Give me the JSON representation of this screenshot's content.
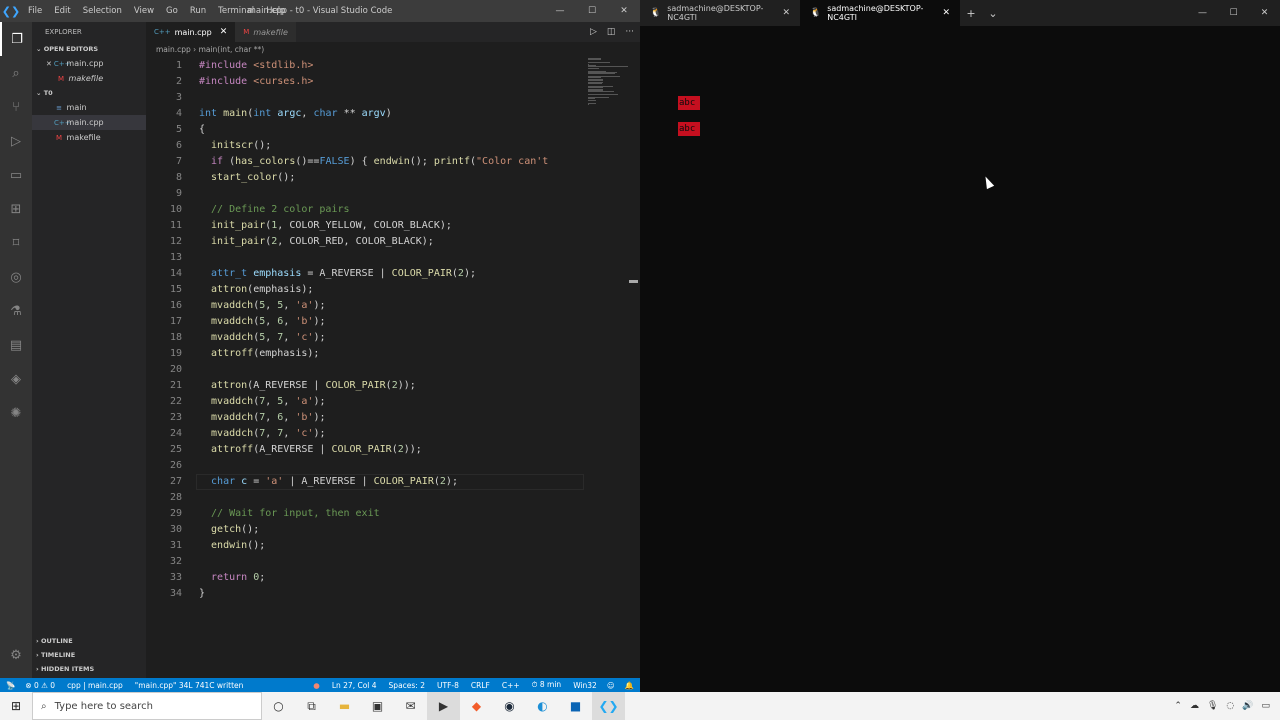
{
  "vscode": {
    "menu": [
      "File",
      "Edit",
      "Selection",
      "View",
      "Go",
      "Run",
      "Terminal",
      "Help"
    ],
    "window_title": "main.cpp - t0 - Visual Studio Code",
    "explorer_label": "EXPLORER",
    "open_editors_label": "OPEN EDITORS",
    "open_editors": [
      {
        "name": "main.cpp",
        "icon": "C++"
      },
      {
        "name": "makefile",
        "icon": "M"
      }
    ],
    "folder_name": "T0",
    "files": [
      {
        "name": "main",
        "icon": "≡"
      },
      {
        "name": "main.cpp",
        "icon": "C++"
      },
      {
        "name": "makefile",
        "icon": "M"
      }
    ],
    "outline_label": "OUTLINE",
    "timeline_label": "TIMELINE",
    "hidden_label": "HIDDEN ITEMS",
    "tabs": [
      {
        "name": "main.cpp",
        "icon": "C++"
      },
      {
        "name": "makefile",
        "icon": "M"
      }
    ],
    "breadcrumb": [
      "main.cpp",
      "main(int, char **)"
    ],
    "code": [
      [
        [
          "#include ",
          "#c586c0"
        ],
        [
          "<stdlib.h>",
          "#ce9178"
        ]
      ],
      [
        [
          "#include ",
          "#c586c0"
        ],
        [
          "<curses.h>",
          "#ce9178"
        ]
      ],
      [],
      [
        [
          "int ",
          "#569cd6"
        ],
        [
          "main",
          "#dcdcaa"
        ],
        [
          "(",
          "#d4d4d4"
        ],
        [
          "int ",
          "#569cd6"
        ],
        [
          "argc",
          "#9cdcfe"
        ],
        [
          ", ",
          "#d4d4d4"
        ],
        [
          "char ",
          "#569cd6"
        ],
        [
          "** ",
          "#d4d4d4"
        ],
        [
          "argv",
          "#9cdcfe"
        ],
        [
          ")",
          "#d4d4d4"
        ]
      ],
      [
        [
          "{",
          "#d4d4d4"
        ]
      ],
      [
        [
          "  initscr",
          "#dcdcaa"
        ],
        [
          "();",
          "#d4d4d4"
        ]
      ],
      [
        [
          "  if ",
          "#c586c0"
        ],
        [
          "(",
          "#d4d4d4"
        ],
        [
          "has_colors",
          "#dcdcaa"
        ],
        [
          "()==",
          "#d4d4d4"
        ],
        [
          "FALSE",
          "#569cd6"
        ],
        [
          ") { ",
          "#d4d4d4"
        ],
        [
          "endwin",
          "#dcdcaa"
        ],
        [
          "(); ",
          "#d4d4d4"
        ],
        [
          "printf",
          "#dcdcaa"
        ],
        [
          "(",
          "#d4d4d4"
        ],
        [
          "\"Color can't",
          "#ce9178"
        ]
      ],
      [
        [
          "  start_color",
          "#dcdcaa"
        ],
        [
          "();",
          "#d4d4d4"
        ]
      ],
      [],
      [
        [
          "  // Define 2 color pairs",
          "#6a9955"
        ]
      ],
      [
        [
          "  init_pair",
          "#dcdcaa"
        ],
        [
          "(",
          "#d4d4d4"
        ],
        [
          "1",
          "#b5cea8"
        ],
        [
          ", COLOR_YELLOW, COLOR_BLACK);",
          "#d4d4d4"
        ]
      ],
      [
        [
          "  init_pair",
          "#dcdcaa"
        ],
        [
          "(",
          "#d4d4d4"
        ],
        [
          "2",
          "#b5cea8"
        ],
        [
          ", COLOR_RED, COLOR_BLACK);",
          "#d4d4d4"
        ]
      ],
      [],
      [
        [
          "  attr_t ",
          "#569cd6"
        ],
        [
          "emphasis ",
          "#9cdcfe"
        ],
        [
          "= A_REVERSE ",
          "#d4d4d4"
        ],
        [
          "| ",
          "#d4d4d4"
        ],
        [
          "COLOR_PAIR",
          "#dcdcaa"
        ],
        [
          "(",
          "#d4d4d4"
        ],
        [
          "2",
          "#b5cea8"
        ],
        [
          ");",
          "#d4d4d4"
        ]
      ],
      [
        [
          "  attron",
          "#dcdcaa"
        ],
        [
          "(emphasis);",
          "#d4d4d4"
        ]
      ],
      [
        [
          "  mvaddch",
          "#dcdcaa"
        ],
        [
          "(",
          "#d4d4d4"
        ],
        [
          "5",
          "#b5cea8"
        ],
        [
          ", ",
          "#d4d4d4"
        ],
        [
          "5",
          "#b5cea8"
        ],
        [
          ", ",
          "#d4d4d4"
        ],
        [
          "'a'",
          "#ce9178"
        ],
        [
          ");",
          "#d4d4d4"
        ]
      ],
      [
        [
          "  mvaddch",
          "#dcdcaa"
        ],
        [
          "(",
          "#d4d4d4"
        ],
        [
          "5",
          "#b5cea8"
        ],
        [
          ", ",
          "#d4d4d4"
        ],
        [
          "6",
          "#b5cea8"
        ],
        [
          ", ",
          "#d4d4d4"
        ],
        [
          "'b'",
          "#ce9178"
        ],
        [
          ");",
          "#d4d4d4"
        ]
      ],
      [
        [
          "  mvaddch",
          "#dcdcaa"
        ],
        [
          "(",
          "#d4d4d4"
        ],
        [
          "5",
          "#b5cea8"
        ],
        [
          ", ",
          "#d4d4d4"
        ],
        [
          "7",
          "#b5cea8"
        ],
        [
          ", ",
          "#d4d4d4"
        ],
        [
          "'c'",
          "#ce9178"
        ],
        [
          ");",
          "#d4d4d4"
        ]
      ],
      [
        [
          "  attroff",
          "#dcdcaa"
        ],
        [
          "(emphasis);",
          "#d4d4d4"
        ]
      ],
      [],
      [
        [
          "  attron",
          "#dcdcaa"
        ],
        [
          "(A_REVERSE | ",
          "#d4d4d4"
        ],
        [
          "COLOR_PAIR",
          "#dcdcaa"
        ],
        [
          "(",
          "#d4d4d4"
        ],
        [
          "2",
          "#b5cea8"
        ],
        [
          "));",
          "#d4d4d4"
        ]
      ],
      [
        [
          "  mvaddch",
          "#dcdcaa"
        ],
        [
          "(",
          "#d4d4d4"
        ],
        [
          "7",
          "#b5cea8"
        ],
        [
          ", ",
          "#d4d4d4"
        ],
        [
          "5",
          "#b5cea8"
        ],
        [
          ", ",
          "#d4d4d4"
        ],
        [
          "'a'",
          "#ce9178"
        ],
        [
          ");",
          "#d4d4d4"
        ]
      ],
      [
        [
          "  mvaddch",
          "#dcdcaa"
        ],
        [
          "(",
          "#d4d4d4"
        ],
        [
          "7",
          "#b5cea8"
        ],
        [
          ", ",
          "#d4d4d4"
        ],
        [
          "6",
          "#b5cea8"
        ],
        [
          ", ",
          "#d4d4d4"
        ],
        [
          "'b'",
          "#ce9178"
        ],
        [
          ");",
          "#d4d4d4"
        ]
      ],
      [
        [
          "  mvaddch",
          "#dcdcaa"
        ],
        [
          "(",
          "#d4d4d4"
        ],
        [
          "7",
          "#b5cea8"
        ],
        [
          ", ",
          "#d4d4d4"
        ],
        [
          "7",
          "#b5cea8"
        ],
        [
          ", ",
          "#d4d4d4"
        ],
        [
          "'c'",
          "#ce9178"
        ],
        [
          ");",
          "#d4d4d4"
        ]
      ],
      [
        [
          "  attroff",
          "#dcdcaa"
        ],
        [
          "(A_REVERSE | ",
          "#d4d4d4"
        ],
        [
          "COLOR_PAIR",
          "#dcdcaa"
        ],
        [
          "(",
          "#d4d4d4"
        ],
        [
          "2",
          "#b5cea8"
        ],
        [
          "));",
          "#d4d4d4"
        ]
      ],
      [],
      [
        [
          "  char ",
          "#569cd6"
        ],
        [
          "c ",
          "#9cdcfe"
        ],
        [
          "= ",
          "#d4d4d4"
        ],
        [
          "'a' ",
          "#ce9178"
        ],
        [
          "| A_REVERSE | ",
          "#d4d4d4"
        ],
        [
          "COLOR_PAIR",
          "#dcdcaa"
        ],
        [
          "(",
          "#d4d4d4"
        ],
        [
          "2",
          "#b5cea8"
        ],
        [
          ");",
          "#d4d4d4"
        ]
      ],
      [],
      [
        [
          "  // Wait for input, then exit",
          "#6a9955"
        ]
      ],
      [
        [
          "  getch",
          "#dcdcaa"
        ],
        [
          "();",
          "#d4d4d4"
        ]
      ],
      [
        [
          "  endwin",
          "#dcdcaa"
        ],
        [
          "();",
          "#d4d4d4"
        ]
      ],
      [],
      [
        [
          "  return ",
          "#c586c0"
        ],
        [
          "0",
          "#b5cea8"
        ],
        [
          ";",
          "#d4d4d4"
        ]
      ],
      [
        [
          "}",
          "#d4d4d4"
        ]
      ]
    ],
    "status": {
      "remote": "⚡",
      "problems": "⊗ 0 ⚠ 0",
      "env": "cpp | main.cpp",
      "written": "\"main.cpp\" 34L 741C written",
      "error_dot": "●",
      "position": "Ln 27, Col 4",
      "spaces": "Spaces: 2",
      "encoding": "UTF-8",
      "eol": "CRLF",
      "language": "C++",
      "time": "⏱ 8 min",
      "platform": "Win32",
      "broadcast": "📡",
      "bell": "🔔"
    }
  },
  "terminal": {
    "tabs": [
      {
        "title": "sadmachine@DESKTOP-NC4GTI",
        "icon": "🐧"
      },
      {
        "title": "sadmachine@DESKTOP-NC4GTI",
        "icon": "🐧"
      }
    ],
    "output": [
      "abc",
      "abc"
    ]
  },
  "taskbar": {
    "search_placeholder": "Type here to search",
    "apps": [
      "cortana",
      "task-view",
      "file-explorer",
      "store",
      "mail",
      "terminal",
      "brave",
      "steam",
      "edge",
      "outlook",
      "vscode"
    ]
  },
  "colors": {
    "vs_bg": "#1e1e1e",
    "status_bar": "#007acc",
    "term_bg": "#0c0c0c",
    "reverse_red": "#c50f1f"
  }
}
